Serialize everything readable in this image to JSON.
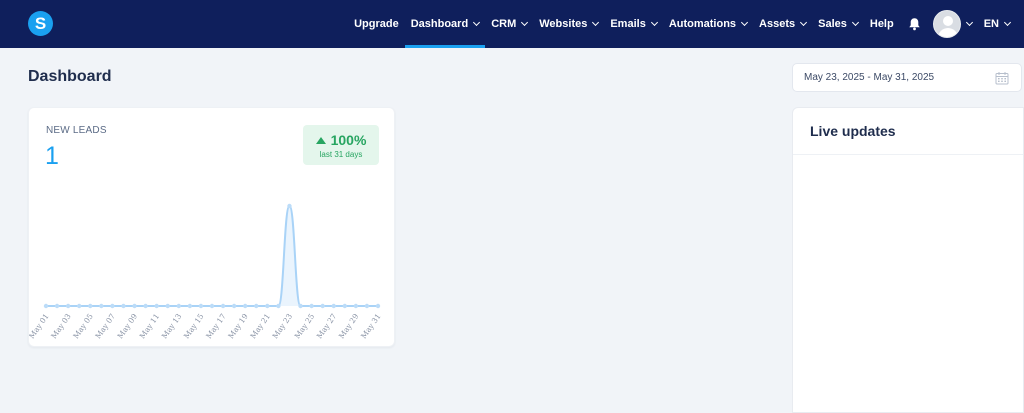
{
  "header": {
    "logo_letter": "S",
    "nav": [
      {
        "label": "Upgrade",
        "dropdown": false,
        "active": false
      },
      {
        "label": "Dashboard",
        "dropdown": true,
        "active": true
      },
      {
        "label": "CRM",
        "dropdown": true,
        "active": false
      },
      {
        "label": "Websites",
        "dropdown": true,
        "active": false
      },
      {
        "label": "Emails",
        "dropdown": true,
        "active": false
      },
      {
        "label": "Automations",
        "dropdown": true,
        "active": false
      },
      {
        "label": "Assets",
        "dropdown": true,
        "active": false
      },
      {
        "label": "Sales",
        "dropdown": true,
        "active": false
      },
      {
        "label": "Help",
        "dropdown": false,
        "active": false
      }
    ],
    "language": "EN",
    "colors": {
      "bar": "#0f1f5c",
      "accent": "#1aa0f0"
    }
  },
  "page": {
    "title": "Dashboard",
    "date_range": "May 23, 2025 - May 31, 2025"
  },
  "leads_card": {
    "label": "NEW LEADS",
    "value": "1",
    "change": "100%",
    "change_period": "last 31 days",
    "change_color": "#27a561"
  },
  "chart_data": {
    "type": "area",
    "x": [
      "May 01",
      "May 02",
      "May 03",
      "May 04",
      "May 05",
      "May 06",
      "May 07",
      "May 08",
      "May 09",
      "May 10",
      "May 11",
      "May 12",
      "May 13",
      "May 14",
      "May 15",
      "May 16",
      "May 17",
      "May 18",
      "May 19",
      "May 20",
      "May 21",
      "May 22",
      "May 23",
      "May 24",
      "May 25",
      "May 26",
      "May 27",
      "May 28",
      "May 29",
      "May 30",
      "May 31"
    ],
    "tick_labels": [
      "May 01",
      "May 03",
      "May 05",
      "May 07",
      "May 09",
      "May 11",
      "May 13",
      "May 15",
      "May 17",
      "May 19",
      "May 21",
      "May 23",
      "May 25",
      "May 27",
      "May 29",
      "May 31"
    ],
    "series": [
      {
        "values": [
          0,
          0,
          0,
          0,
          0,
          0,
          0,
          0,
          0,
          0,
          0,
          0,
          0,
          0,
          0,
          0,
          0,
          0,
          0,
          0,
          0,
          0,
          1,
          0,
          0,
          0,
          0,
          0,
          0,
          0,
          0
        ]
      }
    ],
    "ylim": [
      0,
      1
    ],
    "grid": false,
    "color": "#a9d3f7"
  },
  "live_updates": {
    "title": "Live updates"
  }
}
